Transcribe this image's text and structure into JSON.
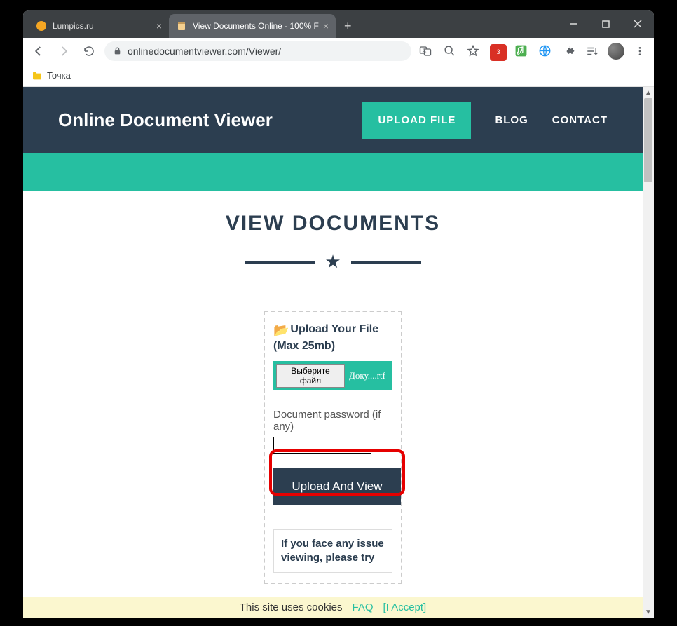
{
  "browser": {
    "tabs": [
      {
        "title": "Lumpics.ru",
        "active": false
      },
      {
        "title": "View Documents Online - 100% F",
        "active": true
      }
    ],
    "url": "onlinedocumentviewer.com/Viewer/",
    "bookmark": "Точка",
    "opera_badge": "3"
  },
  "site": {
    "title": "Online Document Viewer",
    "nav": {
      "upload": "UPLOAD FILE",
      "blog": "BLOG",
      "contact": "CONTACT"
    }
  },
  "main": {
    "heading": "VIEW DOCUMENTS"
  },
  "card": {
    "upload_label_1": "Upload Your File",
    "upload_label_2": "(Max 25mb)",
    "choose_btn": "Выберите файл",
    "filename": "Доку....rtf",
    "pw_label": "Document password ",
    "pw_hint": "(if any)",
    "pw_value": "",
    "submit": "Upload And View",
    "issue": "If you face any issue viewing, please try"
  },
  "cookie": {
    "text": "This site uses cookies",
    "faq": "FAQ",
    "accept": "[I Accept]"
  }
}
